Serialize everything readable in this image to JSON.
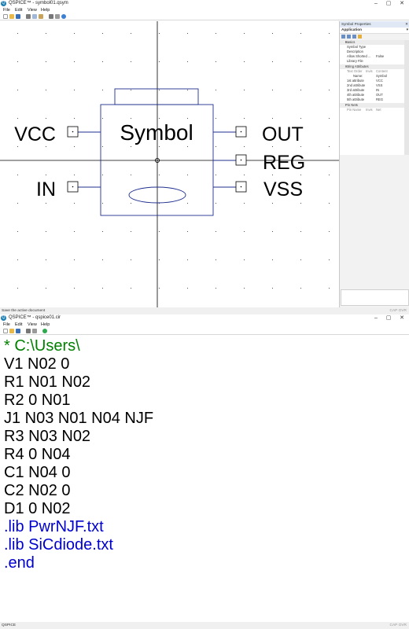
{
  "window1": {
    "title": "QSPICE™ - symbol01.qsym",
    "menu": [
      "File",
      "Edit",
      "View",
      "Help"
    ],
    "status_left": "Save the active document",
    "status_right": "CAP  OVR"
  },
  "symbol": {
    "name": "Symbol",
    "pins_left": [
      "VCC",
      "IN"
    ],
    "pins_right": [
      "OUT",
      "REG",
      "VSS"
    ]
  },
  "properties": {
    "panel_title": "Symbol Properties",
    "selected": "Application",
    "basics_label": "Basics",
    "basics": [
      {
        "key": "Symbol Type",
        "value": ""
      },
      {
        "key": "Description",
        "value": ""
      },
      {
        "key": "Allow Shorted ...",
        "value": "False"
      },
      {
        "key": "Library File",
        "value": ""
      }
    ],
    "string_attr_label": "String Attributes",
    "string_attr_header": [
      "Text Order",
      "Invis",
      "Content"
    ],
    "string_attrs": [
      {
        "key": "Name:",
        "value": "Symbol"
      },
      {
        "key": "1st attribute",
        "value": "VCC"
      },
      {
        "key": "2nd attribute",
        "value": "VSS"
      },
      {
        "key": "3rd attribute",
        "value": "IN"
      },
      {
        "key": "4th attribute",
        "value": "OUT"
      },
      {
        "key": "5th attribute",
        "value": "REG"
      }
    ],
    "pin_nets_label": "Pin Nets",
    "pin_nets_header": [
      "Pin Name",
      "Invis",
      "Net"
    ]
  },
  "window2": {
    "title": "QSPICE™ - qspice01.cir",
    "menu": [
      "File",
      "Edit",
      "View",
      "Help"
    ],
    "status_left": "QSPICE",
    "status_right": "CAP  OVR",
    "lines": [
      {
        "text": "* C:\\Users\\",
        "kind": "comment"
      },
      {
        "text": "V1 N02 0",
        "kind": "normal"
      },
      {
        "text": "R1 N01 N02",
        "kind": "normal"
      },
      {
        "text": "R2 0 N01",
        "kind": "normal"
      },
      {
        "text": "J1 N03 N01 N04 NJF",
        "kind": "normal"
      },
      {
        "text": "R3 N03 N02",
        "kind": "normal"
      },
      {
        "text": "R4 0 N04",
        "kind": "normal"
      },
      {
        "text": "C1 N04 0",
        "kind": "normal"
      },
      {
        "text": "C2 N02 0",
        "kind": "normal"
      },
      {
        "text": "D1 0 N02",
        "kind": "normal"
      },
      {
        "text": ".lib PwrNJF.txt",
        "kind": "directive"
      },
      {
        "text": ".lib SiCdiode.txt",
        "kind": "directive"
      },
      {
        "text": ".end",
        "kind": "directive"
      }
    ]
  },
  "icons": {
    "app": "qspice-app-icon",
    "minimize": "minimize-icon",
    "maximize": "maximize-icon",
    "close": "close-icon"
  },
  "glyphs": {
    "minimize": "–",
    "maximize": "▢",
    "close": "✕",
    "close_small": "✕",
    "dropdown": "▾",
    "pin": "📌",
    "app": "Q"
  }
}
